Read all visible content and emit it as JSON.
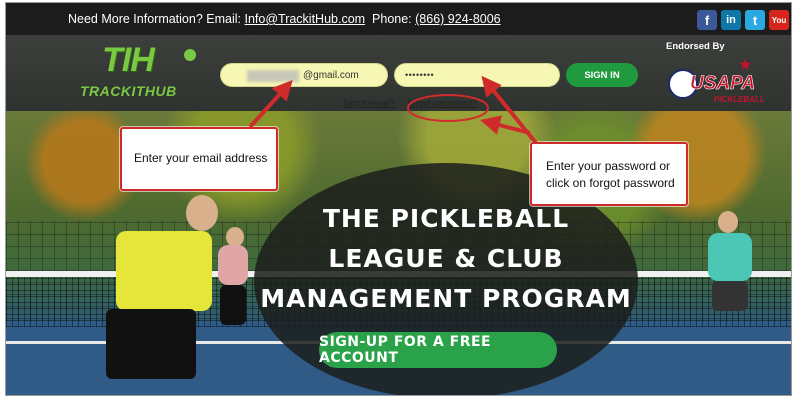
{
  "infobar": {
    "prefix": "Need More Information? Email:",
    "email": "Info@TrackitHub.com",
    "phone_label": "Phone:",
    "phone": "(866) 924-8006",
    "social": [
      {
        "name": "facebook-icon",
        "glyph": "f"
      },
      {
        "name": "linkedin-icon",
        "glyph": "in"
      },
      {
        "name": "twitter-icon",
        "glyph": "t"
      },
      {
        "name": "youtube-icon",
        "glyph": "You"
      }
    ]
  },
  "logo": {
    "mark": "TIH",
    "word": "TRACKITHUB"
  },
  "login": {
    "email_value": "@gmail.com",
    "password_value": "••••••••",
    "signin_label": "SIGN IN",
    "forgot_email": "forgot email?",
    "forgot_password": "forgot password?"
  },
  "endorsement": {
    "label": "Endorsed By",
    "org": "USAPA",
    "sub": "PICKLEBALL"
  },
  "hero": {
    "title_line1": "THE PICKLEBALL",
    "title_line2": "LEAGUE & CLUB",
    "title_line3": "MANAGEMENT PROGRAM",
    "cta": "SIGN-UP FOR A FREE ACCOUNT"
  },
  "callouts": {
    "email_hint": "Enter your email address",
    "password_hint_line1": "Enter your password or",
    "password_hint_line2": "click on forgot password"
  },
  "colors": {
    "accent_green": "#2aa24a",
    "callout_red": "#d02b2b",
    "field_yellow": "#f6f7b3"
  }
}
